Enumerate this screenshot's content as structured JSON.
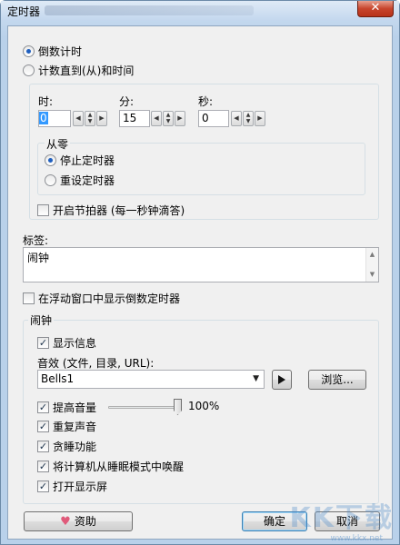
{
  "window": {
    "title": "定时器",
    "close_glyph": "✕"
  },
  "mode": {
    "countdown_label": "倒数计时",
    "countup_label": "计数直到(从)和时间",
    "selected": "countdown"
  },
  "time": {
    "hour_label": "时:",
    "minute_label": "分:",
    "second_label": "秒:",
    "hour_value": "0",
    "minute_value": "15",
    "second_value": "0"
  },
  "zero_group": {
    "title": "从零",
    "stop_label": "停止定时器",
    "reset_label": "重设定时器",
    "selected": "stop"
  },
  "metronome_label": "开启节拍器 (每一秒钟滴答)",
  "tag": {
    "label": "标签:",
    "value": "闹钟"
  },
  "float_window_label": "在浮动窗口中显示倒数定时器",
  "alarm": {
    "title": "闹钟",
    "show_info_label": "显示信息",
    "sound_label": "音效 (文件, 目录, URL):",
    "sound_value": "Bells1",
    "browse_label": "浏览...",
    "volume_label": "提高音量",
    "volume_percent": "100%",
    "volume_fraction": 1.0,
    "repeat_label": "重复声音",
    "snooze_label": "贪睡功能",
    "wake_label": "将计算机从睡眠模式中唤醒",
    "display_on_label": "打开显示屏"
  },
  "buttons": {
    "donate": "资助",
    "ok": "确定",
    "cancel": "取消"
  },
  "watermark": {
    "text": "KK下载",
    "sub": "www.kkx.net"
  },
  "icons": {
    "play": "play-icon",
    "heart": "heart-icon",
    "spin_left": "◀",
    "spin_right": "▶",
    "spin_up": "▲",
    "spin_down": "▼",
    "dropdown": "▼"
  }
}
